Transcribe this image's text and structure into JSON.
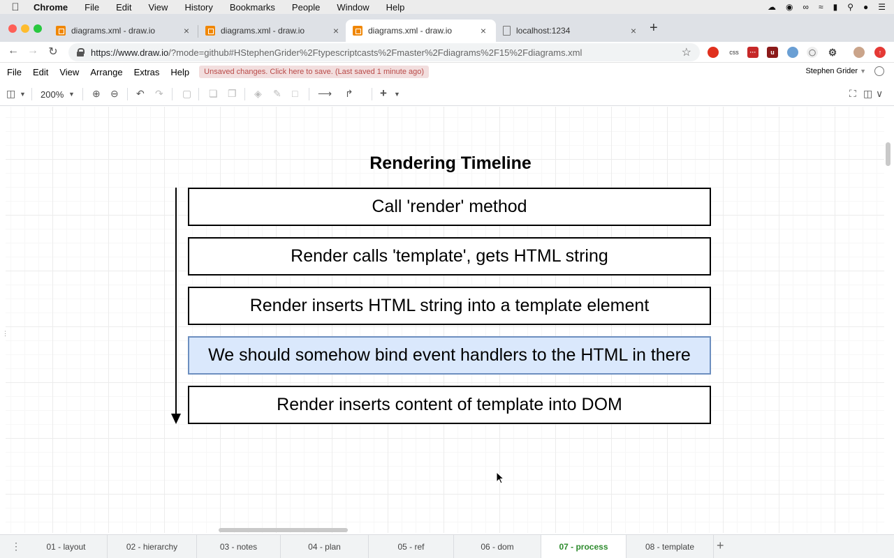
{
  "mac_menu": {
    "apple": "",
    "app": "Chrome",
    "items": [
      "File",
      "Edit",
      "View",
      "History",
      "Bookmarks",
      "People",
      "Window",
      "Help"
    ]
  },
  "browser": {
    "tabs": [
      {
        "title": "diagrams.xml - draw.io",
        "close": "×"
      },
      {
        "title": "diagrams.xml - draw.io",
        "close": "×"
      },
      {
        "title": "diagrams.xml - draw.io",
        "close": "×"
      },
      {
        "title": "localhost:1234",
        "close": "×"
      }
    ],
    "new_tab": "+",
    "url_host": "https://www.draw.io",
    "url_path": "/?mode=github#HStephenGrider%2Ftypescriptcasts%2Fmaster%2Fdiagrams%2F15%2Fdiagrams.xml",
    "ext_css": "css"
  },
  "app": {
    "menu": [
      "File",
      "Edit",
      "View",
      "Arrange",
      "Extras",
      "Help"
    ],
    "unsaved_notice": "Unsaved changes. Click here to save. (Last saved 1 minute ago)",
    "user": "Stephen Grider"
  },
  "toolbar": {
    "zoom": "200%"
  },
  "diagram": {
    "title": "Rendering Timeline",
    "steps": [
      "Call 'render' method",
      "Render calls 'template', gets HTML string",
      "Render inserts HTML string into a template element",
      "We should somehow bind event handlers to the HTML in there",
      "Render inserts content of template into DOM"
    ]
  },
  "pages": {
    "tabs": [
      "01 - layout",
      "02 - hierarchy",
      "03 - notes",
      "04 - plan",
      "05 - ref",
      "06 - dom",
      "07 - process",
      "08 - template"
    ],
    "active": "07 - process"
  },
  "colors": {
    "selected_fill": "#dae8fc",
    "selected_stroke": "#6c8ebf",
    "active_page": "#2e8b2e",
    "drawio_orange": "#f08705"
  }
}
